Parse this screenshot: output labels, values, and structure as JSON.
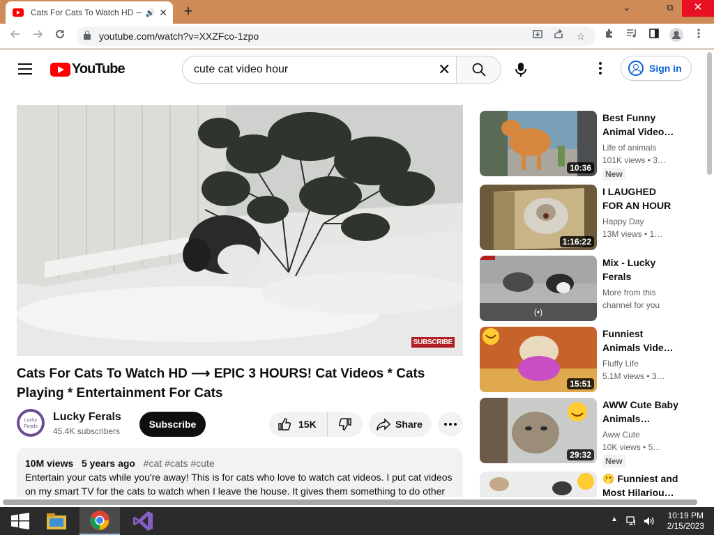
{
  "browser": {
    "tab_title": "Cats For Cats To Watch HD ⟶",
    "url": "youtube.com/watch?v=XXZFco-1zpo",
    "new_tab": "+",
    "minimize": "⌄",
    "restore": "⧉",
    "close": "✕"
  },
  "header": {
    "logo_text": "YouTube",
    "search_value": "cute cat video hour",
    "signin_label": "Sign in"
  },
  "player": {
    "subscribe_watermark": "SUBSCRIBE"
  },
  "video": {
    "title": "Cats For Cats To Watch HD ⟶ EPIC 3 HOURS! Cat Videos * Cats Playing * Entertainment For Cats",
    "channel": "Lucky Ferals",
    "avatar_text": "Lucky Ferals",
    "subscribers": "45.4K subscribers",
    "subscribe_label": "Subscribe",
    "likes": "15K",
    "share_label": "Share"
  },
  "description": {
    "views": "10M views",
    "age": "5 years ago",
    "tags": "#cat #cats #cute",
    "text": "Entertain your cats while you're away! This is for cats who love to watch cat videos. I put cat videos on my smart TV for the cats to watch when I leave the house. It gives them something to do other"
  },
  "recommendations": [
    {
      "title": "Best Funny Animal Video…",
      "channel": "Life of animals",
      "views": "101K views",
      "age": "3…",
      "duration": "10:36",
      "badge": "New"
    },
    {
      "title": "I LAUGHED FOR AN HOUR😹…",
      "channel": "Happy Day",
      "views": "13M views",
      "age": "1…",
      "duration": "1:16:22",
      "badge": ""
    },
    {
      "title": "Mix - Lucky Ferals",
      "channel": "More from this channel for you",
      "views": "",
      "age": "",
      "duration": "",
      "badge": "",
      "mix_icon": "(•)"
    },
    {
      "title": "Funniest Animals Vide…",
      "channel": "Fluffy Life",
      "views": "5.1M views",
      "age": "3…",
      "duration": "15:51",
      "badge": ""
    },
    {
      "title": "AWW Cute Baby Animals…",
      "channel": "Aww Cute",
      "views": "10K views",
      "age": "5…",
      "duration": "29:32",
      "badge": "New"
    },
    {
      "title": "🫢 Funniest and Most Hilariou…",
      "channel": "",
      "views": "",
      "age": "",
      "duration": "",
      "badge": ""
    }
  ],
  "taskbar": {
    "time": "10:19 PM",
    "date": "2/15/2023"
  },
  "colors": {
    "youtube_red": "#ff0000",
    "link_blue": "#065fd4",
    "titlebar": "#cf8b57"
  }
}
